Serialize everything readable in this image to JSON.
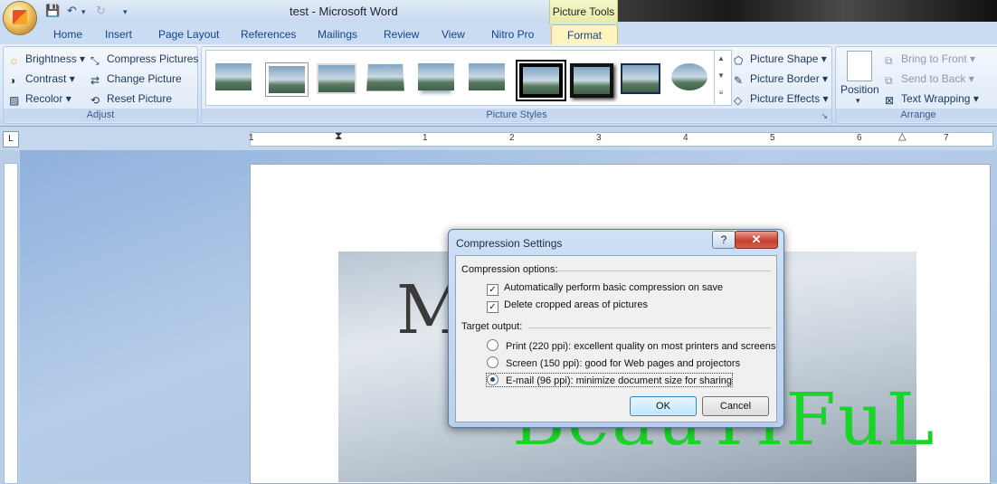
{
  "window": {
    "title": "test - Microsoft Word",
    "context_tab_group": "Picture Tools"
  },
  "tabs": [
    "Home",
    "Insert",
    "Page Layout",
    "References",
    "Mailings",
    "Review",
    "View",
    "Nitro Pro",
    "Format"
  ],
  "ribbon": {
    "adjust": {
      "label": "Adjust",
      "brightness": "Brightness",
      "contrast": "Contrast",
      "recolor": "Recolor",
      "compress": "Compress Pictures",
      "change": "Change Picture",
      "reset": "Reset Picture"
    },
    "styles": {
      "label": "Picture Styles",
      "shape": "Picture Shape",
      "border": "Picture Border",
      "effects": "Picture Effects"
    },
    "arrange": {
      "label": "Arrange",
      "position": "Position",
      "bring_front": "Bring to Front",
      "send_back": "Send to Back",
      "text_wrapping": "Text Wrapping"
    }
  },
  "ruler": {
    "numbers": [
      "1",
      "1",
      "2",
      "3",
      "4",
      "5",
      "6",
      "7"
    ]
  },
  "document": {
    "wordart_top": "M",
    "wordart_bottom": "BeauTIFuL"
  },
  "dialog": {
    "title": "Compression Settings",
    "help": "?",
    "close": "✕",
    "compression_options_label": "Compression options:",
    "auto_compress": "Automatically perform basic compression on save",
    "delete_cropped": "Delete cropped areas of pictures",
    "target_output_label": "Target output:",
    "print": "Print (220 ppi): excellent quality on most printers and screens",
    "screen": "Screen (150 ppi): good for Web pages and projectors",
    "email": "E-mail (96 ppi): minimize document size for sharing",
    "ok": "OK",
    "cancel": "Cancel"
  }
}
